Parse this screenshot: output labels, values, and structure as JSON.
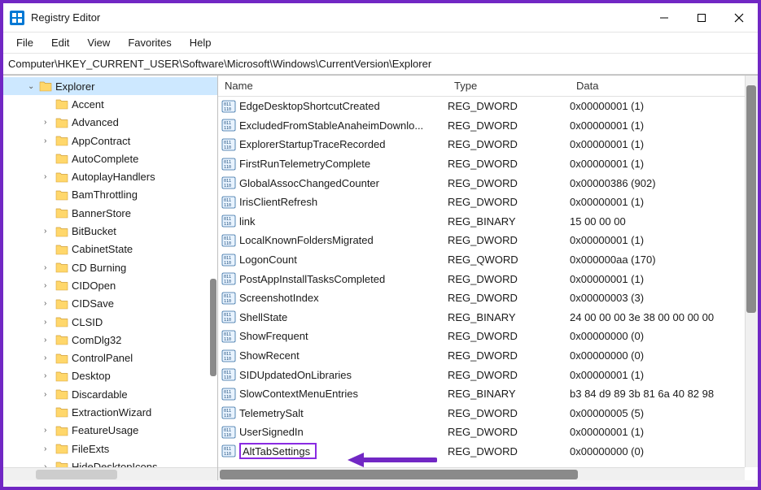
{
  "window": {
    "title": "Registry Editor"
  },
  "menu": {
    "items": [
      "File",
      "Edit",
      "View",
      "Favorites",
      "Help"
    ]
  },
  "address": {
    "path": "Computer\\HKEY_CURRENT_USER\\Software\\Microsoft\\Windows\\CurrentVersion\\Explorer"
  },
  "tree": {
    "items": [
      {
        "label": "Explorer",
        "expandable": true,
        "expanded": true,
        "selected": true,
        "depth": 0
      },
      {
        "label": "Accent",
        "expandable": false,
        "depth": 1
      },
      {
        "label": "Advanced",
        "expandable": true,
        "depth": 1
      },
      {
        "label": "AppContract",
        "expandable": true,
        "depth": 1
      },
      {
        "label": "AutoComplete",
        "expandable": false,
        "depth": 1
      },
      {
        "label": "AutoplayHandlers",
        "expandable": true,
        "depth": 1
      },
      {
        "label": "BamThrottling",
        "expandable": false,
        "depth": 1
      },
      {
        "label": "BannerStore",
        "expandable": false,
        "depth": 1
      },
      {
        "label": "BitBucket",
        "expandable": true,
        "depth": 1
      },
      {
        "label": "CabinetState",
        "expandable": false,
        "depth": 1
      },
      {
        "label": "CD Burning",
        "expandable": true,
        "depth": 1
      },
      {
        "label": "CIDOpen",
        "expandable": true,
        "depth": 1
      },
      {
        "label": "CIDSave",
        "expandable": true,
        "depth": 1
      },
      {
        "label": "CLSID",
        "expandable": true,
        "depth": 1
      },
      {
        "label": "ComDlg32",
        "expandable": true,
        "depth": 1
      },
      {
        "label": "ControlPanel",
        "expandable": true,
        "depth": 1
      },
      {
        "label": "Desktop",
        "expandable": true,
        "depth": 1
      },
      {
        "label": "Discardable",
        "expandable": true,
        "depth": 1
      },
      {
        "label": "ExtractionWizard",
        "expandable": false,
        "depth": 1
      },
      {
        "label": "FeatureUsage",
        "expandable": true,
        "depth": 1
      },
      {
        "label": "FileExts",
        "expandable": true,
        "depth": 1
      },
      {
        "label": "HideDesktopIcons",
        "expandable": true,
        "depth": 1
      }
    ]
  },
  "list": {
    "headers": {
      "name": "Name",
      "type": "Type",
      "data": "Data"
    },
    "rows": [
      {
        "name": "EdgeDesktopShortcutCreated",
        "type": "REG_DWORD",
        "data": "0x00000001 (1)"
      },
      {
        "name": "ExcludedFromStableAnaheimDownlo...",
        "type": "REG_DWORD",
        "data": "0x00000001 (1)"
      },
      {
        "name": "ExplorerStartupTraceRecorded",
        "type": "REG_DWORD",
        "data": "0x00000001 (1)"
      },
      {
        "name": "FirstRunTelemetryComplete",
        "type": "REG_DWORD",
        "data": "0x00000001 (1)"
      },
      {
        "name": "GlobalAssocChangedCounter",
        "type": "REG_DWORD",
        "data": "0x00000386 (902)"
      },
      {
        "name": "IrisClientRefresh",
        "type": "REG_DWORD",
        "data": "0x00000001 (1)"
      },
      {
        "name": "link",
        "type": "REG_BINARY",
        "data": "15 00 00 00"
      },
      {
        "name": "LocalKnownFoldersMigrated",
        "type": "REG_DWORD",
        "data": "0x00000001 (1)"
      },
      {
        "name": "LogonCount",
        "type": "REG_QWORD",
        "data": "0x000000aa (170)"
      },
      {
        "name": "PostAppInstallTasksCompleted",
        "type": "REG_DWORD",
        "data": "0x00000001 (1)"
      },
      {
        "name": "ScreenshotIndex",
        "type": "REG_DWORD",
        "data": "0x00000003 (3)"
      },
      {
        "name": "ShellState",
        "type": "REG_BINARY",
        "data": "24 00 00 00 3e 38 00 00 00 00"
      },
      {
        "name": "ShowFrequent",
        "type": "REG_DWORD",
        "data": "0x00000000 (0)"
      },
      {
        "name": "ShowRecent",
        "type": "REG_DWORD",
        "data": "0x00000000 (0)"
      },
      {
        "name": "SIDUpdatedOnLibraries",
        "type": "REG_DWORD",
        "data": "0x00000001 (1)"
      },
      {
        "name": "SlowContextMenuEntries",
        "type": "REG_BINARY",
        "data": "b3 84 d9 89 3b 81 6a 40 82 98"
      },
      {
        "name": "TelemetrySalt",
        "type": "REG_DWORD",
        "data": "0x00000005 (5)"
      },
      {
        "name": "UserSignedIn",
        "type": "REG_DWORD",
        "data": "0x00000001 (1)"
      },
      {
        "name": "AltTabSettings",
        "type": "REG_DWORD",
        "data": "0x00000000 (0)",
        "editing": true
      }
    ]
  },
  "annotation": {
    "color": "#7127c4"
  }
}
